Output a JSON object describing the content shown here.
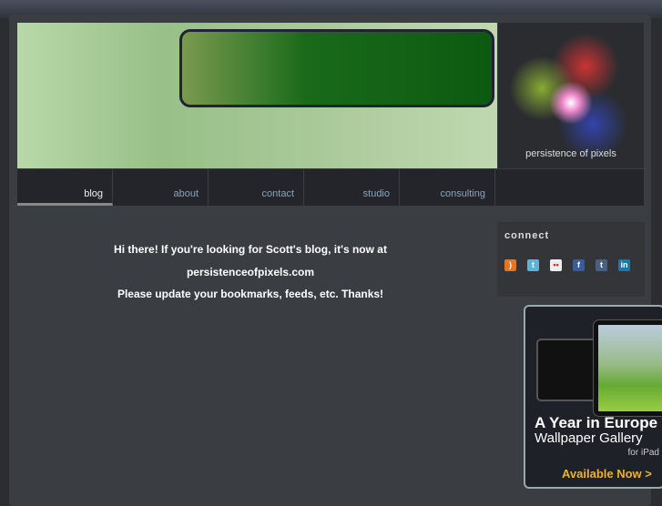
{
  "brand": {
    "tagline": "persistence of pixels"
  },
  "nav": [
    "blog",
    "about",
    "contact",
    "studio",
    "consulting"
  ],
  "message": [
    "Hi there! If you're looking for Scott's blog, it's now at",
    "persistenceofpixels.com",
    "Please update your bookmarks, feeds, etc. Thanks!"
  ],
  "connect": {
    "title": "connect",
    "icons": [
      "rss-icon",
      "twitter-icon",
      "flickr-icon",
      "facebook-icon",
      "tumblr-icon",
      "linkedin-icon"
    ]
  },
  "ad": {
    "line1": "A Year in Europe",
    "line2": "Wallpaper Gallery",
    "line3": "for iPad",
    "cta": "Available Now >"
  }
}
